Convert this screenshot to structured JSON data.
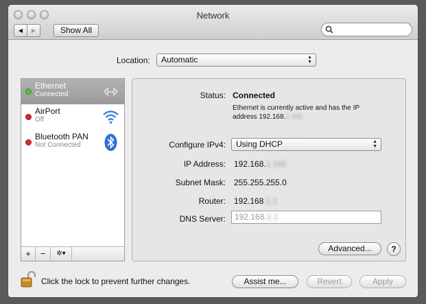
{
  "window": {
    "title": "Network"
  },
  "toolbar": {
    "back": "◀",
    "forward": "▶",
    "show_all": "Show All",
    "search_placeholder": ""
  },
  "location": {
    "label": "Location:",
    "value": "Automatic"
  },
  "services": [
    {
      "name": "Ethernet",
      "status": "Connected",
      "dot_color": "#53c03a",
      "icon": "ethernet-icon",
      "selected": true
    },
    {
      "name": "AirPort",
      "status": "Off",
      "dot_color": "#e0252a",
      "icon": "wifi-icon",
      "selected": false
    },
    {
      "name": "Bluetooth PAN",
      "status": "Not Connected",
      "dot_color": "#e0252a",
      "icon": "bluetooth-icon",
      "selected": false
    }
  ],
  "sidebar_tools": {
    "add": "+",
    "remove": "−",
    "action": "✲▾"
  },
  "details": {
    "status_label": "Status:",
    "status_value": "Connected",
    "status_description_line1": "Ethernet is currently active and has the IP",
    "status_description_line2": "address 192.168.",
    "status_description_hidden": "1.100",
    "configure_label": "Configure IPv4:",
    "configure_value": "Using DHCP",
    "ip_label": "IP Address:",
    "ip_value": "192.168.",
    "ip_hidden": "1.100",
    "subnet_label": "Subnet Mask:",
    "subnet_value": "255.255.255.0",
    "router_label": "Router:",
    "router_value": "192.168",
    "router_hidden": ".1.1",
    "dns_label": "DNS Server:",
    "dns_value": "192.168.",
    "dns_hidden": "1.1",
    "advanced": "Advanced...",
    "help": "?"
  },
  "footer": {
    "lock_text": "Click the lock to prevent further changes.",
    "assist": "Assist me...",
    "revert": "Revert",
    "apply": "Apply"
  },
  "colors": {
    "selection": "#a6a6a6",
    "connected": "#53c03a",
    "off": "#e0252a",
    "bluetooth": "#2f6fd6",
    "wifi": "#3a86d8"
  }
}
